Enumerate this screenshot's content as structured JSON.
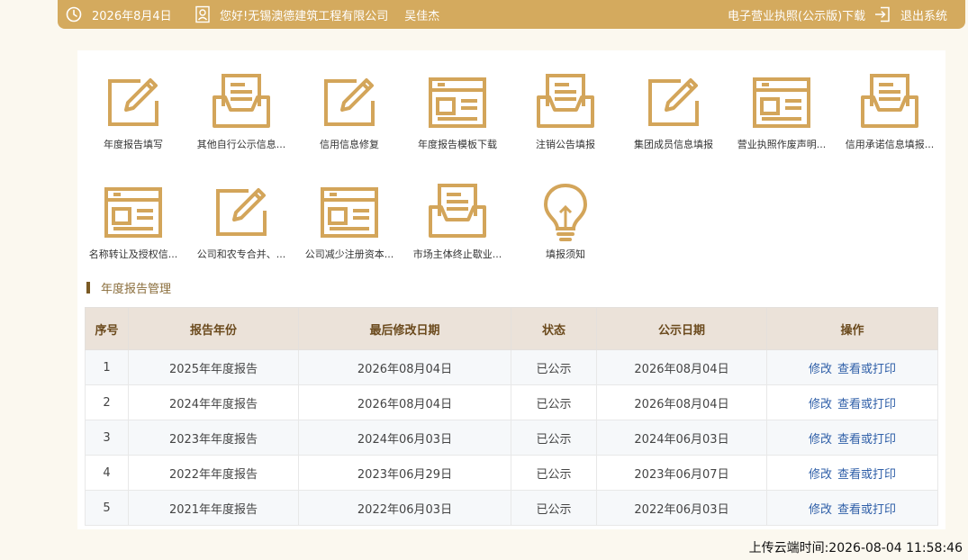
{
  "header": {
    "date": "2026年8月4日",
    "greeting": "您好!无锡澳德建筑工程有限公司",
    "username": "吴佳杰",
    "license_download": "电子营业执照(公示版)下载",
    "logout": "退出系统"
  },
  "colors": {
    "brand": "#d4aa5e",
    "icon": "#d3a55a",
    "header_row": "#ebe2d9",
    "link": "#2f5fa8"
  },
  "tiles": [
    {
      "label": "年度报告填写",
      "icon": "edit-icon"
    },
    {
      "label": "其他自行公示信息...",
      "icon": "inbox-icon"
    },
    {
      "label": "信用信息修复",
      "icon": "edit-icon"
    },
    {
      "label": "年度报告模板下载",
      "icon": "template-icon"
    },
    {
      "label": "注销公告填报",
      "icon": "inbox-icon"
    },
    {
      "label": "集团成员信息填报",
      "icon": "edit-icon"
    },
    {
      "label": "营业执照作废声明...",
      "icon": "template-icon"
    },
    {
      "label": "信用承诺信息填报...",
      "icon": "inbox-icon"
    },
    {
      "label": "名称转让及授权信...",
      "icon": "template-icon"
    },
    {
      "label": "公司和农专合并、...",
      "icon": "edit-icon"
    },
    {
      "label": "公司减少注册资本...",
      "icon": "template-icon"
    },
    {
      "label": "市场主体终止歇业...",
      "icon": "inbox-icon"
    },
    {
      "label": "填报须知",
      "icon": "lightbulb-icon"
    }
  ],
  "section": {
    "title": "年度报告管理"
  },
  "table": {
    "headers": [
      "序号",
      "报告年份",
      "最后修改日期",
      "状态",
      "公示日期",
      "操作"
    ],
    "rows": [
      {
        "no": "1",
        "year": "2025年年度报告",
        "modified": "2026年08月04日",
        "status": "已公示",
        "published": "2026年08月04日"
      },
      {
        "no": "2",
        "year": "2024年年度报告",
        "modified": "2026年08月04日",
        "status": "已公示",
        "published": "2026年08月04日"
      },
      {
        "no": "3",
        "year": "2023年年度报告",
        "modified": "2024年06月03日",
        "status": "已公示",
        "published": "2024年06月03日"
      },
      {
        "no": "4",
        "year": "2022年年度报告",
        "modified": "2023年06月29日",
        "status": "已公示",
        "published": "2023年06月07日"
      },
      {
        "no": "5",
        "year": "2021年年度报告",
        "modified": "2022年06月03日",
        "status": "已公示",
        "published": "2022年06月03日"
      }
    ],
    "actions": {
      "edit": "修改",
      "view": "查看或打印"
    }
  },
  "footer": {
    "upload_time": "上传云端时间:2026-08-04 11:58:46"
  }
}
